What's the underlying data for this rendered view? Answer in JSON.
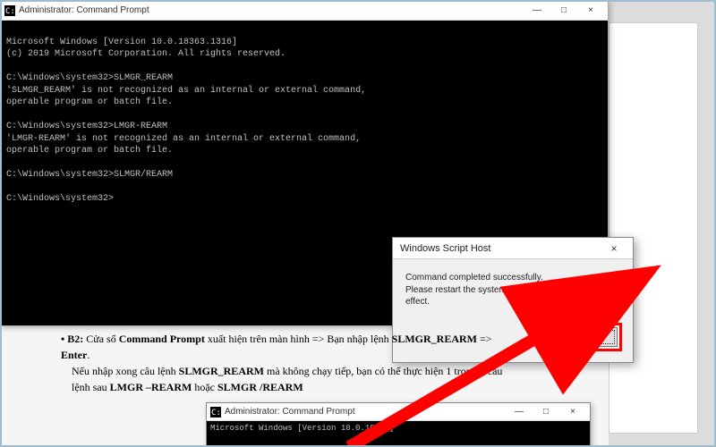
{
  "cmd1": {
    "title": "Administrator: Command Prompt",
    "lines": [
      "Microsoft Windows [Version 10.0.18363.1316]",
      "(c) 2019 Microsoft Corporation. All rights reserved.",
      "",
      "C:\\Windows\\system32>SLMGR_REARM",
      "'SLMGR_REARM' is not recognized as an internal or external command,",
      "operable program or batch file.",
      "",
      "C:\\Windows\\system32>LMGR-REARM",
      "'LMGR-REARM' is not recognized as an internal or external command,",
      "operable program or batch file.",
      "",
      "C:\\Windows\\system32>SLMGR/REARM",
      "",
      "C:\\Windows\\system32>"
    ],
    "min": "—",
    "max": "□",
    "close": "×"
  },
  "dialog": {
    "title": "Windows Script Host",
    "line1": "Command completed successfully.",
    "line2": "Please restart the system for the changes to take effect.",
    "ok": "OK",
    "close": "×"
  },
  "doc": {
    "line1_pre": "B2: ",
    "line1_a": "Cửa sổ ",
    "line1_b": "Command Prompt",
    "line1_c": " xuất hiện trên màn hình => Bạn nhập lệnh ",
    "line1_d": "SLMGR_REARM",
    "line1_e": " =>",
    "line2": "Enter",
    "line2_suffix": ".",
    "line3_a": "Nếu nhập xong câu lệnh ",
    "line3_b": "SLMGR_REARM",
    "line3_c": " mà không chạy tiếp, bạn có thể thực hiện 1 trong 2 câu",
    "line4_a": "lệnh sau ",
    "line4_b": "LMGR –REARM",
    "line4_c": " hoặc ",
    "line4_d": "SLMGR /REARM"
  },
  "cmd2": {
    "title": "Administrator: Command Prompt",
    "line1": "Microsoft Windows [Version 10.0.10586]",
    "min": "—",
    "max": "□",
    "close": "×"
  }
}
